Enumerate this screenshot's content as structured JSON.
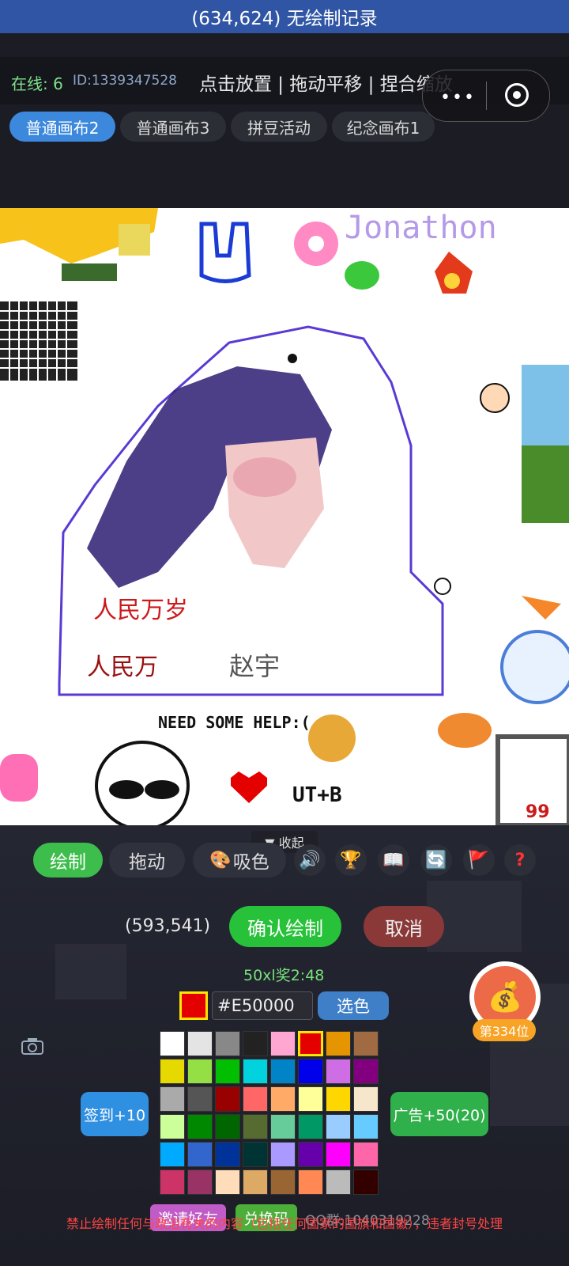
{
  "title_bar": {
    "text": "(634,624) 无绘制记录"
  },
  "info": {
    "online": "在线: 6",
    "user_id": "ID:1339347528",
    "hint": "点击放置 | 拖动平移 | 捏合缩放"
  },
  "tabs": [
    {
      "label": "普通画布2",
      "active": true
    },
    {
      "label": "普通画布3",
      "active": false
    },
    {
      "label": "拼豆活动",
      "active": false
    },
    {
      "label": "纪念画布1",
      "active": false
    }
  ],
  "canvas_texts": {
    "jonathon": "Jonathon",
    "wan_sui": "人民万岁",
    "ren_min": "人民万",
    "need_help": "NEED SOME HELP:(",
    "zhao": "赵宇",
    "ut": "UT+B"
  },
  "panel": {
    "collapse_label": "▼ 收起",
    "draw_label": "绘制",
    "drag_label": "拖动",
    "pick_label": "吸色",
    "coord": "(593,541)",
    "confirm_label": "确认绘制",
    "cancel_label": "取消",
    "reward": "50xl奖2:48",
    "color_hex": "#E50000",
    "pick_color_label": "选色",
    "checkin_label": "签到+10",
    "ad_label": "广告+50(20)",
    "rank_label": "第334位",
    "invite_label": "邀请好友",
    "redeem_label": "兑换码",
    "qq_group": "QQ群:1040319228",
    "warning": "禁止绘制任何与政治有关的内容（包括任何国家的国旗和国徽），违者封号处理"
  },
  "palette": [
    [
      "#ffffff",
      "#e4e4e4",
      "#888888",
      "#222222",
      "#ffa7d1",
      "#e50000",
      "#e59500",
      "#a06a42"
    ],
    [
      "#e5d900",
      "#94e044",
      "#02be01",
      "#00d3dd",
      "#0083c7",
      "#0000ea",
      "#cf6ee4",
      "#820080"
    ],
    [
      "#aaaaaa",
      "#555555",
      "#990000",
      "#ff6666",
      "#ffaa66",
      "#ffff99",
      "#ffd700",
      "#f5e6cc"
    ],
    [
      "#ccff99",
      "#008800",
      "#006600",
      "#556b2f",
      "#66cc99",
      "#009966",
      "#99ccff",
      "#66ccff"
    ],
    [
      "#00aaff",
      "#3366cc",
      "#003399",
      "#003333",
      "#aa99ff",
      "#6600aa",
      "#ff00ff",
      "#ff66aa"
    ],
    [
      "#cc3366",
      "#993366",
      "#ffddbb",
      "#ddaa66",
      "#996633",
      "#ff8855",
      "#bbbbbb",
      "#330000"
    ]
  ],
  "selected_color_index": [
    0,
    5
  ],
  "colors": {
    "title_bar": "#2f55a4",
    "online_green": "#7fe08a",
    "active_tab": "#3c88dc",
    "draw_green": "#3dbd4b",
    "confirm_green": "#27c23a",
    "cancel_red": "#8a3838",
    "checkin_blue": "#2f8fe0",
    "ad_green": "#2fb04a",
    "invite_pink": "#c05cc8",
    "redeem_green": "#4caf3a",
    "warning_red": "#ff4545"
  },
  "icons": [
    "speaker-icon",
    "trophy-icon",
    "book-icon",
    "refresh-icon",
    "flag-icon",
    "help-icon",
    "camera-icon",
    "money-bag-icon",
    "palette-icon"
  ]
}
